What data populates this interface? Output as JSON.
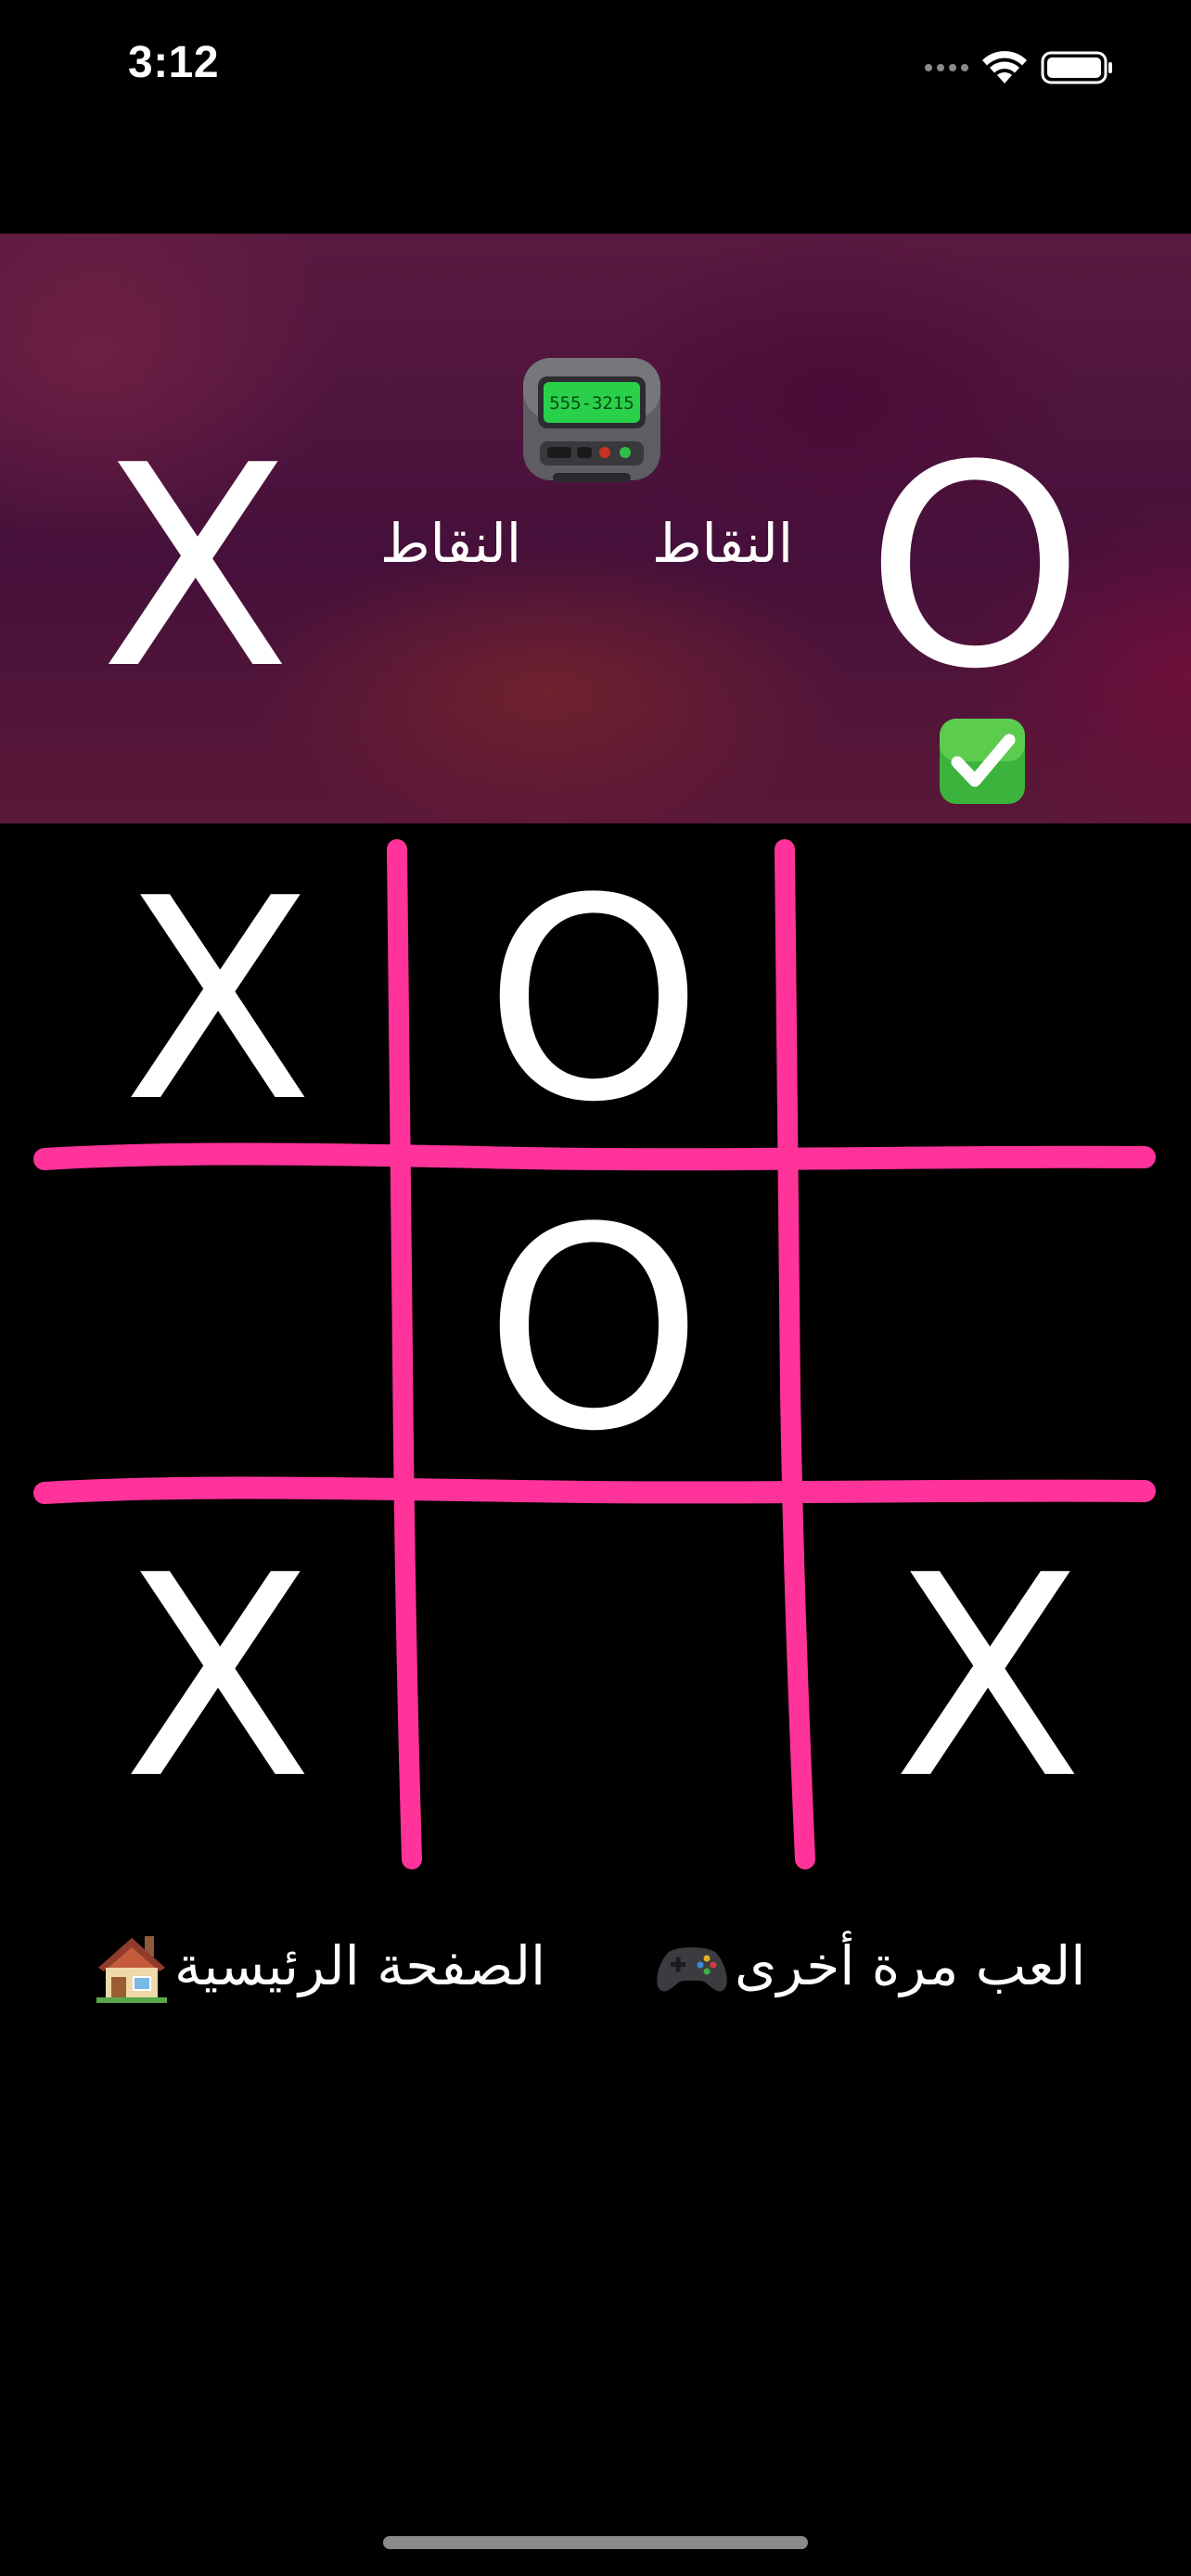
{
  "status_bar": {
    "time": "3:12",
    "icons": [
      "cellular-icon",
      "wifi-icon",
      "battery-icon"
    ]
  },
  "score_panel": {
    "player_x": {
      "symbol": "X",
      "label": "النقاط"
    },
    "player_o": {
      "symbol": "O",
      "label": "النقاط",
      "winner": true
    },
    "pager_display": "555-3215",
    "icons": [
      "pager-icon",
      "check-icon"
    ]
  },
  "board": {
    "line_color": "#FF3399",
    "cells": [
      "X",
      "O",
      "",
      "",
      "O",
      "",
      "X",
      "",
      "X"
    ]
  },
  "buttons": {
    "home": {
      "label": "الصفحة الرئيسية",
      "icon": "house-icon"
    },
    "play_again": {
      "label": "العب مرة أخرى",
      "icon": "game-controller-icon"
    }
  },
  "colors": {
    "background": "#000000",
    "accent": "#FF3399",
    "text": "#FFFFFF"
  }
}
